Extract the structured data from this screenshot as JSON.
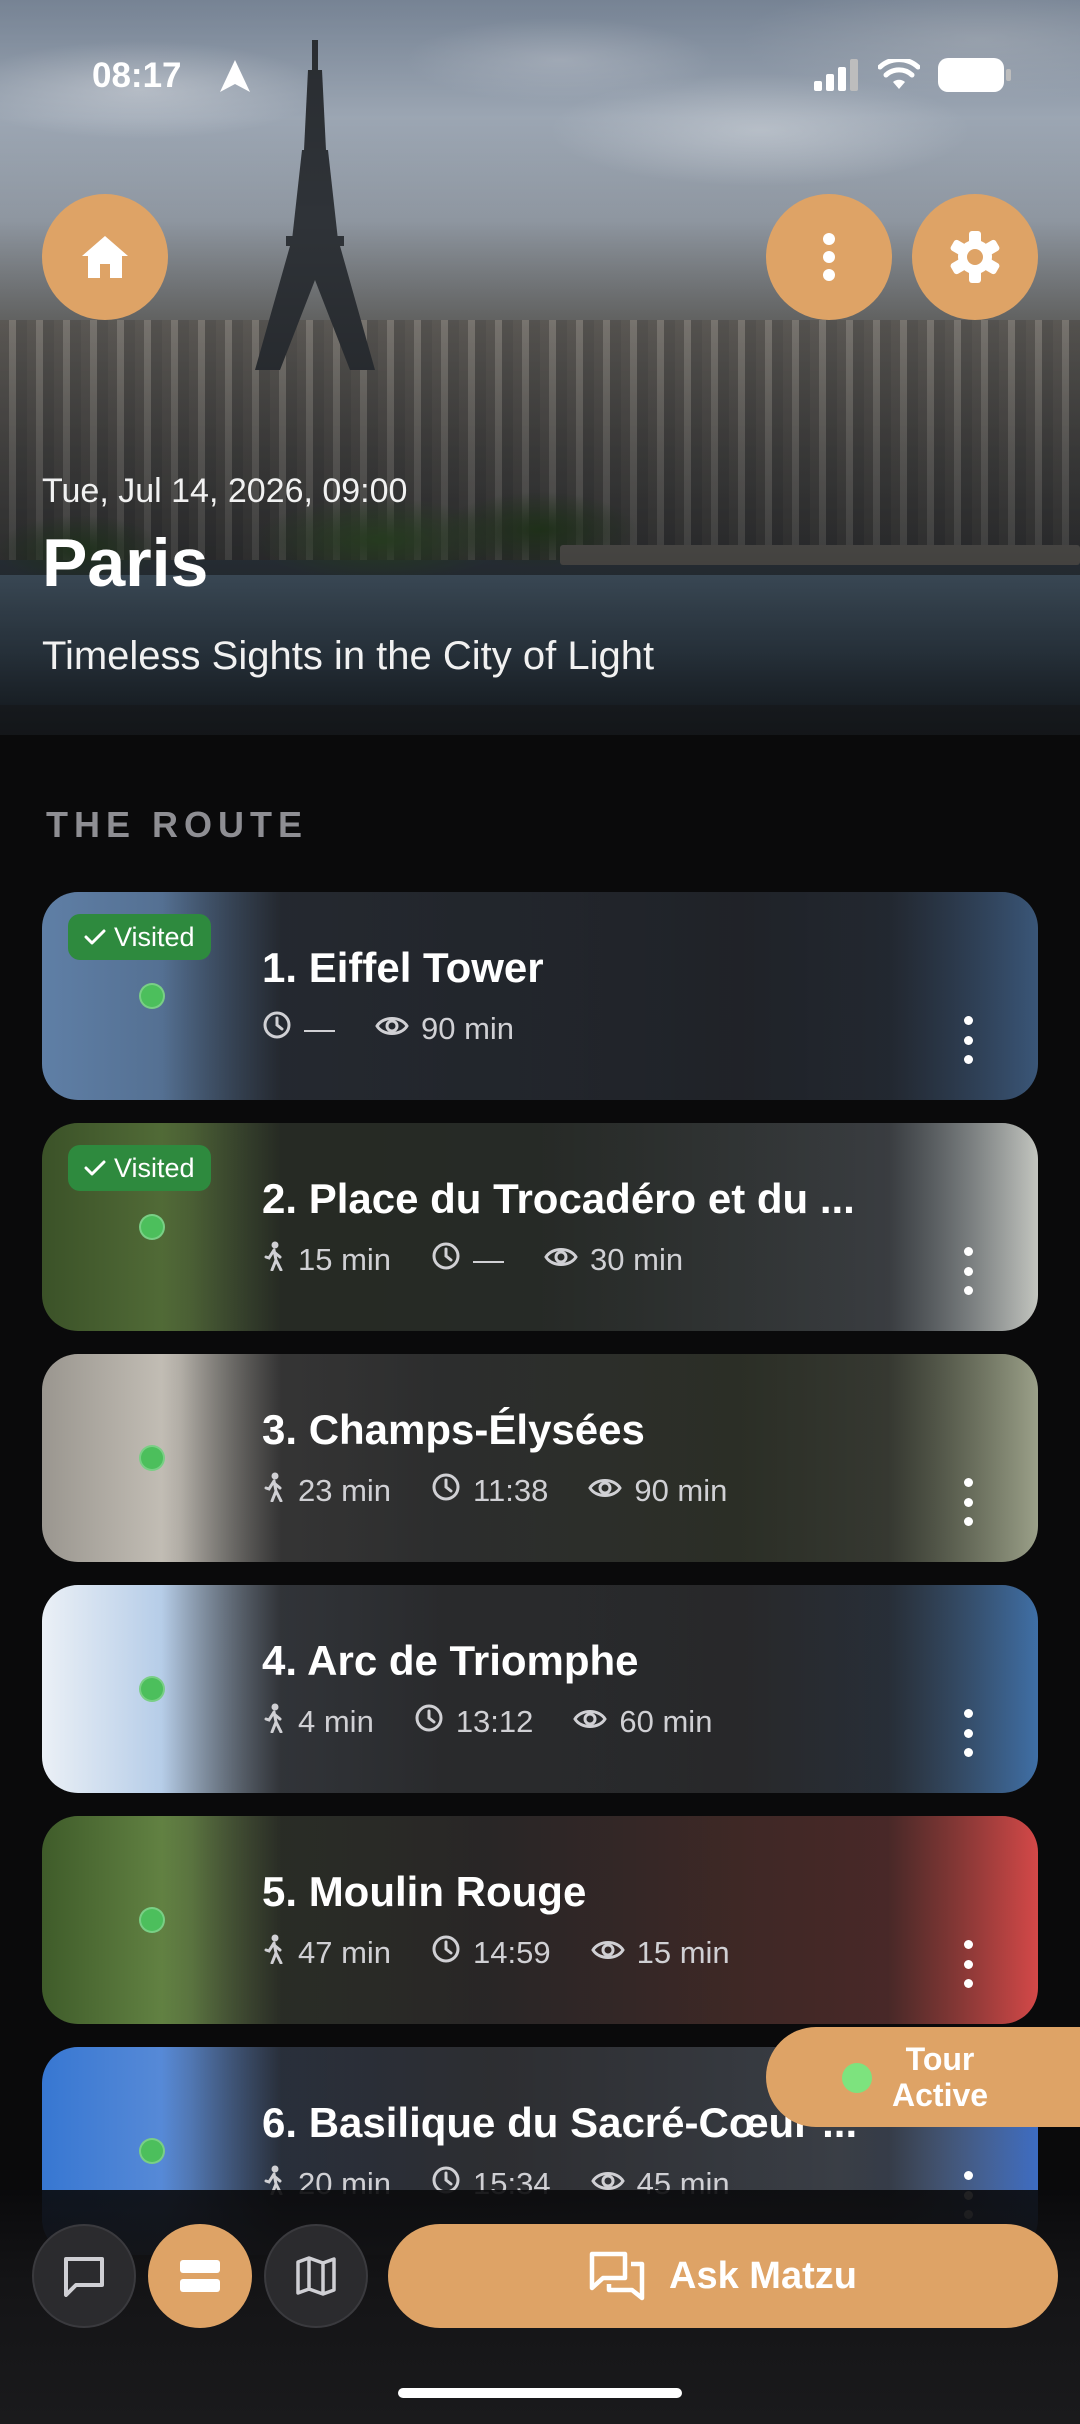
{
  "status": {
    "time": "08:17"
  },
  "hero": {
    "date": "Tue, Jul 14, 2026, 09:00",
    "city": "Paris",
    "subtitle": "Timeless Sights in the City of Light"
  },
  "section_label": "THE ROUTE",
  "stops": [
    {
      "title": "1. Eiffel Tower",
      "visited": true,
      "walk": "",
      "time": "—",
      "duration": "90 min"
    },
    {
      "title": "2. Place du Trocadéro et du ...",
      "visited": true,
      "walk": "15 min",
      "time": "—",
      "duration": "30 min"
    },
    {
      "title": "3. Champs-Élysées",
      "visited": false,
      "walk": "23 min",
      "time": "11:38",
      "duration": "90 min"
    },
    {
      "title": "4. Arc de Triomphe",
      "visited": false,
      "walk": "4 min",
      "time": "13:12",
      "duration": "60 min"
    },
    {
      "title": "5. Moulin Rouge",
      "visited": false,
      "walk": "47 min",
      "time": "14:59",
      "duration": "15 min"
    },
    {
      "title": "6. Basilique du Sacré-Cœur ...",
      "visited": false,
      "walk": "20 min",
      "time": "15:34",
      "duration": "45 min"
    }
  ],
  "visited_label": "Visited",
  "tour_status": {
    "line1": "Tour",
    "line2": "Active"
  },
  "bottom_nav": {
    "ask_label": "Ask Matzu"
  },
  "colors": {
    "accent": "#dea366",
    "visited": "#2e8a3e",
    "dot": "#4cbf5c"
  }
}
